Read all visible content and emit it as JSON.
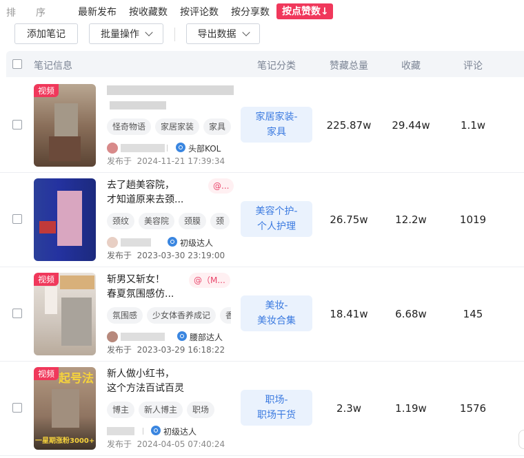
{
  "sort": {
    "label_chars": [
      "排",
      "序"
    ],
    "tabs": [
      "最新发布",
      "按收藏数",
      "按评论数",
      "按分享数"
    ],
    "active_tab": "按点赞数",
    "active_arrow": "↓"
  },
  "toolbar": {
    "add_note": "添加笔记",
    "batch": "批量操作",
    "export": "导出数据"
  },
  "table": {
    "headers": {
      "info": "笔记信息",
      "category": "笔记分类",
      "total": "赞藏总量",
      "collect": "收藏",
      "comment": "评论"
    },
    "rows": [
      {
        "video_tag": "视频",
        "title_line1": "",
        "title_line2": "",
        "mention": "",
        "tags": [
          "怪奇物语",
          "家居家装",
          "家具"
        ],
        "badge": "头部KOL",
        "published_label": "发布于",
        "published": "2024-11-21 17:39:34",
        "category_line1": "家居家装-",
        "category_line2": "家具",
        "total": "225.87w",
        "collect": "29.44w",
        "comment": "1.1w"
      },
      {
        "video_tag": "",
        "title_line1": "去了趟美容院，",
        "title_line2": "才知道原来去颈...",
        "mention": "@...",
        "tags": [
          "颈纹",
          "美容院",
          "颈膜",
          "颈"
        ],
        "badge": "初级达人",
        "published_label": "发布于",
        "published": "2023-03-30 23:19:00",
        "category_line1": "美容个护-",
        "category_line2": "个人护理",
        "total": "26.75w",
        "collect": "12.2w",
        "comment": "1019"
      },
      {
        "video_tag": "视频",
        "title_line1": "斩男又斩女！",
        "title_line2": "春夏氛围感仿...",
        "mention": "@（M...",
        "tags": [
          "氛围感",
          "少女体香养成记",
          "香"
        ],
        "badge": "腰部达人",
        "published_label": "发布于",
        "published": "2023-03-29 16:18:22",
        "category_line1": "美妆-",
        "category_line2": "美妆合集",
        "total": "18.41w",
        "collect": "6.68w",
        "comment": "145"
      },
      {
        "video_tag": "视频",
        "title_line1": "新人做小红书，",
        "title_line2": "这个方法百试百灵",
        "mention": "",
        "tags": [
          "博主",
          "新人博主",
          "职场"
        ],
        "badge": "初级达人",
        "published_label": "发布于",
        "published": "2024-04-05 07:40:24",
        "category_line1": "职场-",
        "category_line2": "职场干货",
        "total": "2.3w",
        "collect": "1.19w",
        "comment": "1576"
      }
    ]
  },
  "thumb_overlay_text": {
    "t4_top": "起号法",
    "t4_bottom": "一星期涨粉3000+"
  },
  "colors": {
    "accent": "#f0385b",
    "category_bg": "#eaf2fd",
    "category_text": "#3b7ae0",
    "header_bg": "#f3f5f8"
  }
}
